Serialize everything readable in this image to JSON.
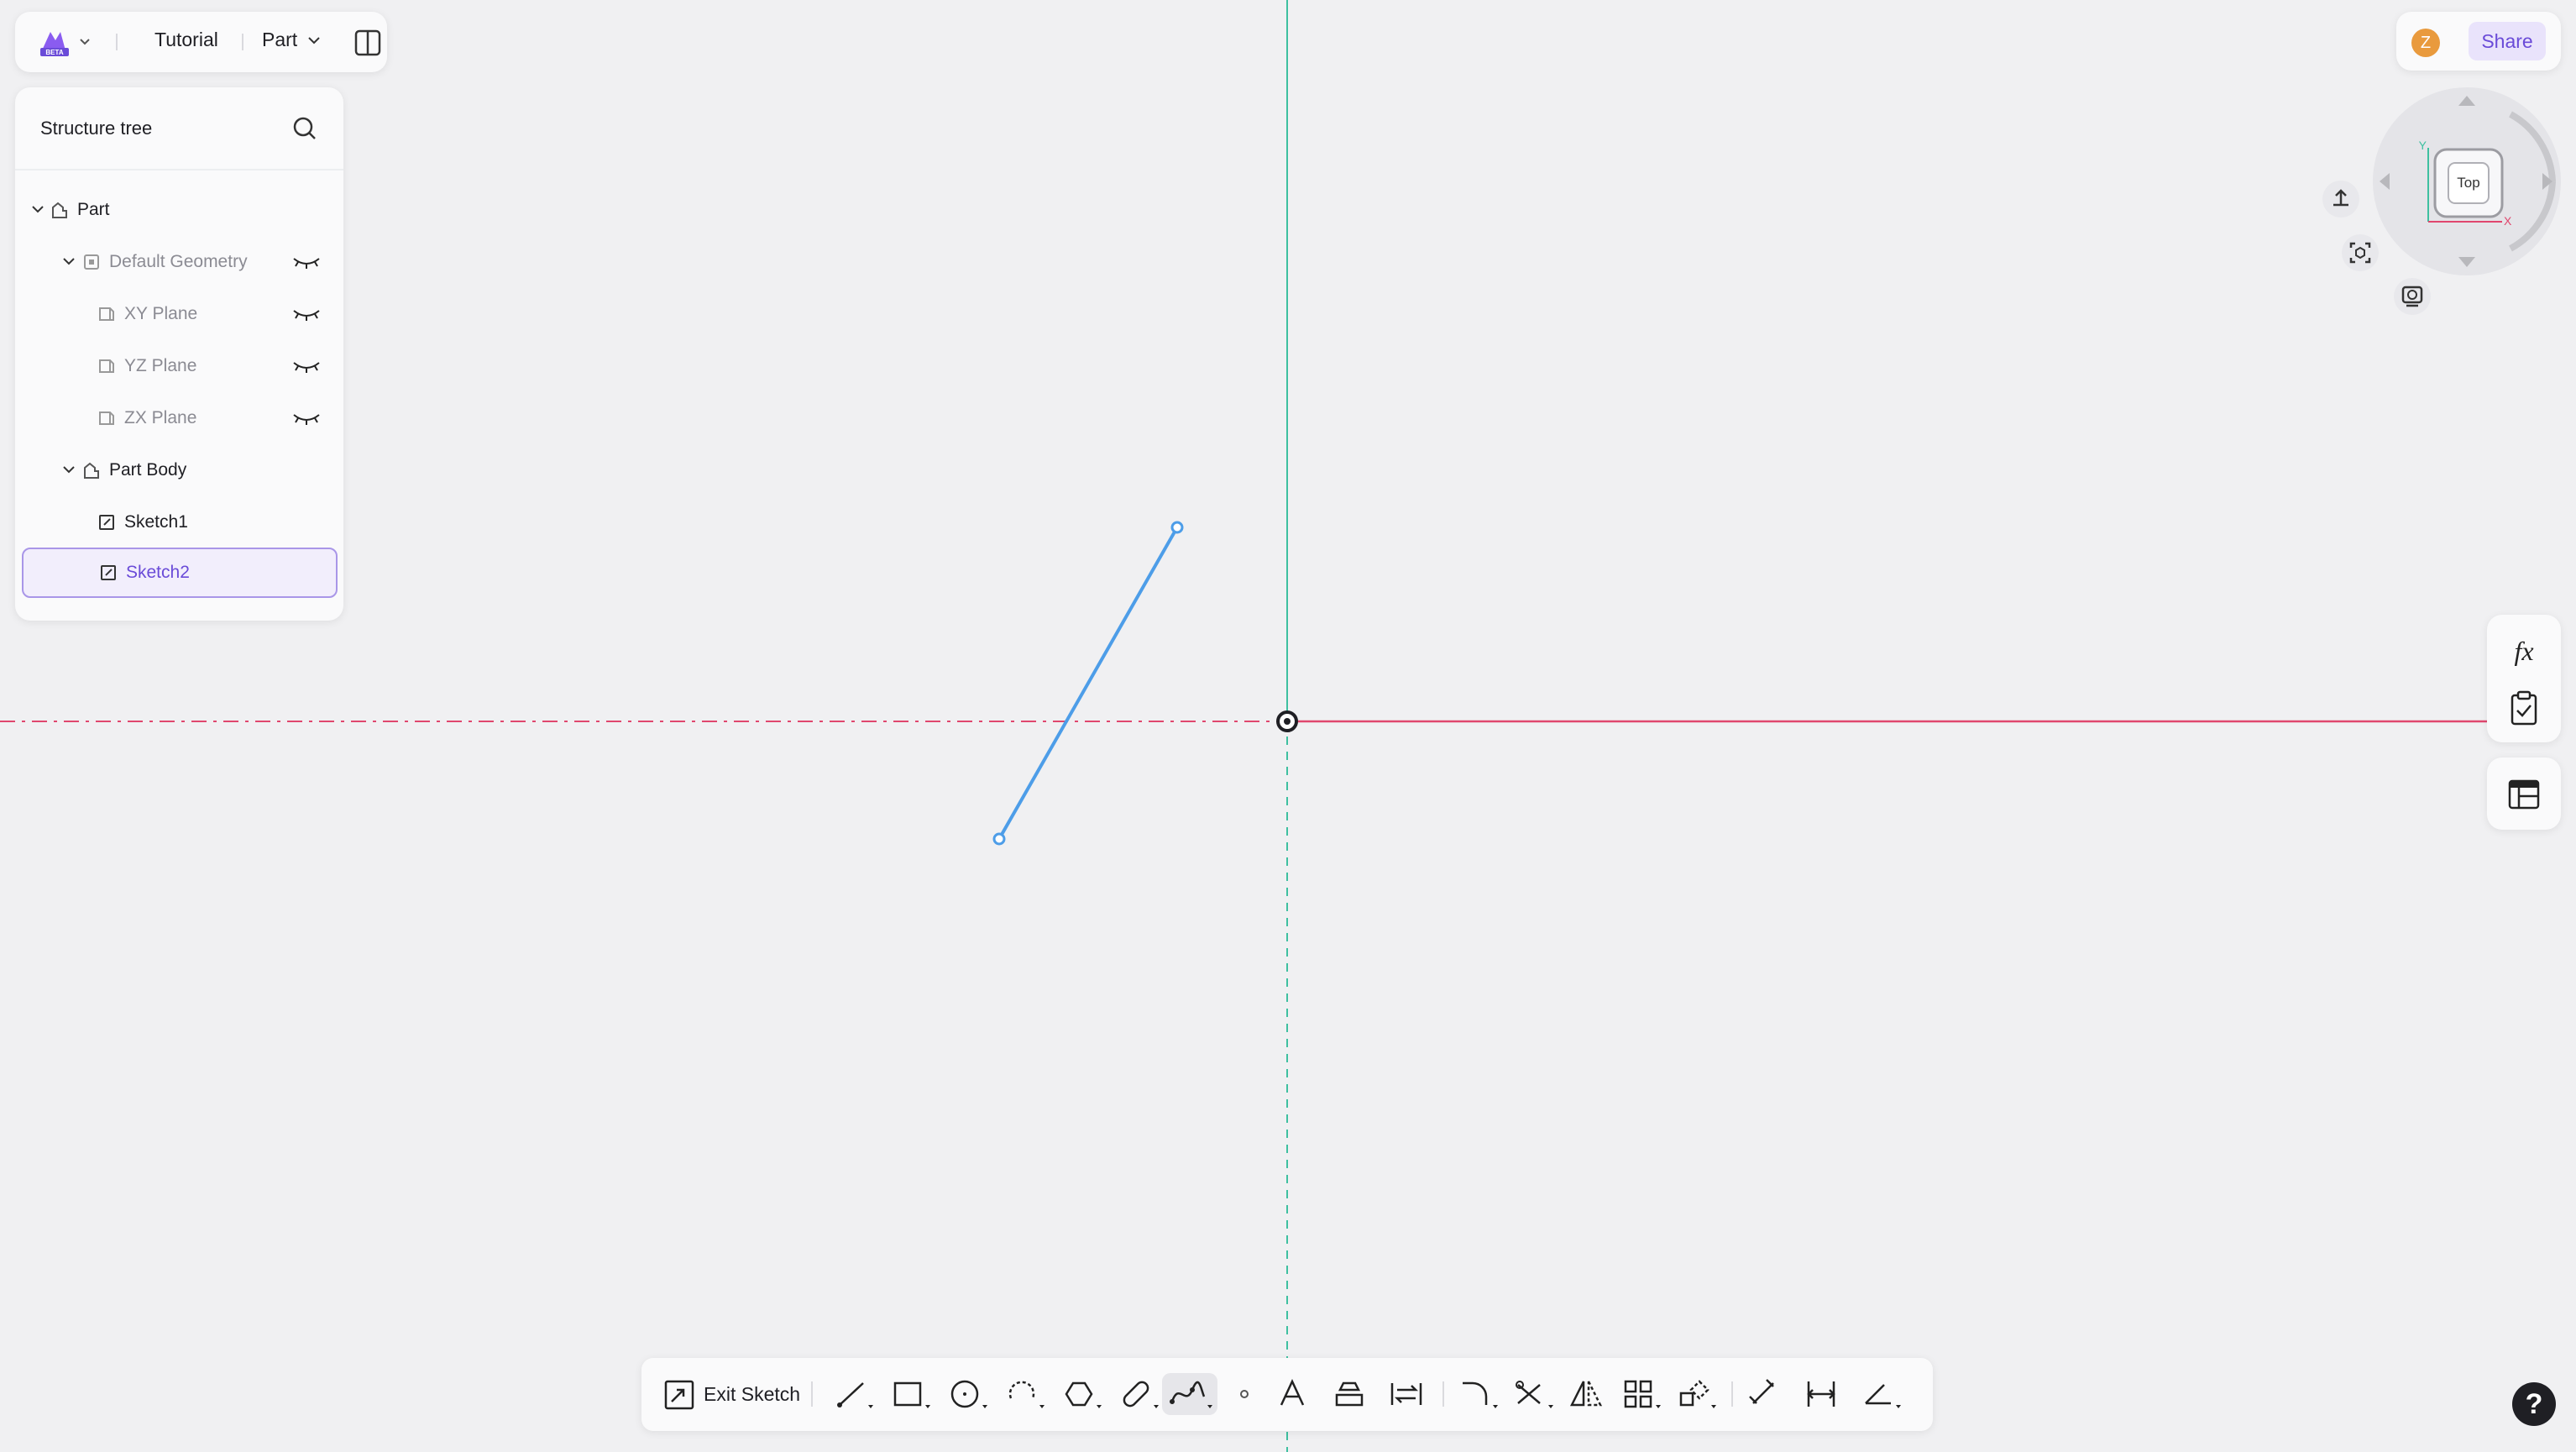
{
  "topbar": {
    "logo_badge": "BETA",
    "document_name": "Tutorial",
    "mode_label": "Part"
  },
  "tree": {
    "title": "Structure tree",
    "items": [
      {
        "label": "Part"
      },
      {
        "label": "Default Geometry"
      },
      {
        "label": "XY Plane"
      },
      {
        "label": "YZ Plane"
      },
      {
        "label": "ZX Plane"
      },
      {
        "label": "Part Body"
      },
      {
        "label": "Sketch1"
      },
      {
        "label": "Sketch2"
      }
    ]
  },
  "user": {
    "avatar_initial": "Z",
    "share_label": "Share"
  },
  "viewcube": {
    "face_label": "Top",
    "axis_x": "X",
    "axis_y": "Y"
  },
  "toolbar": {
    "exit_label": "Exit Sketch"
  },
  "help": {
    "label": "?"
  },
  "colors": {
    "accent": "#6a4bd8",
    "sketch_line": "#4d9de8",
    "x_axis": "#e0476e",
    "y_axis": "#3ec0a0"
  }
}
